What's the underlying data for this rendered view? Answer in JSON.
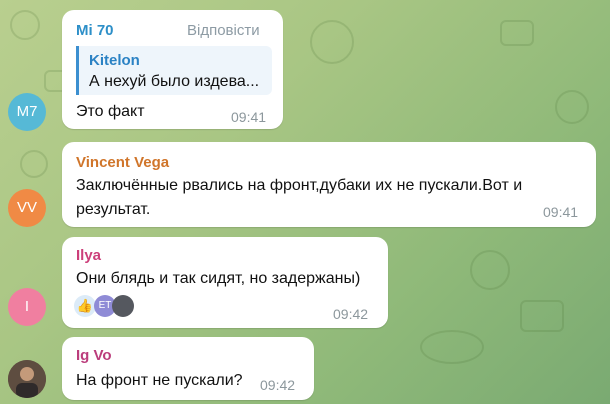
{
  "messages": [
    {
      "avatar": {
        "initials": "M7",
        "color": "#56b9d6"
      },
      "name": "Mi 70",
      "name_color": "#2d8fc8",
      "reply_action": "Відповісти",
      "quote": {
        "name": "Kitelon",
        "text": "А нехуй было издева..."
      },
      "text": "Это факт",
      "time": "09:41"
    },
    {
      "avatar": {
        "initials": "VV",
        "color": "#f08a45"
      },
      "name": "Vincent Vega",
      "name_color": "#d0752a",
      "text_line1": "Заключённые рвались на фронт,дубаки их не пускали.Вот и",
      "text_line2": "результат.",
      "time": "09:41"
    },
    {
      "avatar": {
        "initials": "I",
        "color": "#f07fa0"
      },
      "name": "Ilya",
      "name_color": "#cc3f7a",
      "text": "Они блядь и так сидят, но задержаны)",
      "reactions": [
        {
          "icon": "thumbs-up-icon",
          "label": "👍"
        },
        {
          "icon": "avatar-et",
          "label": "ET"
        },
        {
          "icon": "avatar-photo",
          "label": ""
        }
      ],
      "time": "09:42"
    },
    {
      "avatar": {
        "initials": "",
        "color": "#6b5a4a"
      },
      "name": "Ig Vo",
      "name_color": "#bb3d7c",
      "text": "На фронт не пускали?",
      "time": "09:42"
    }
  ]
}
